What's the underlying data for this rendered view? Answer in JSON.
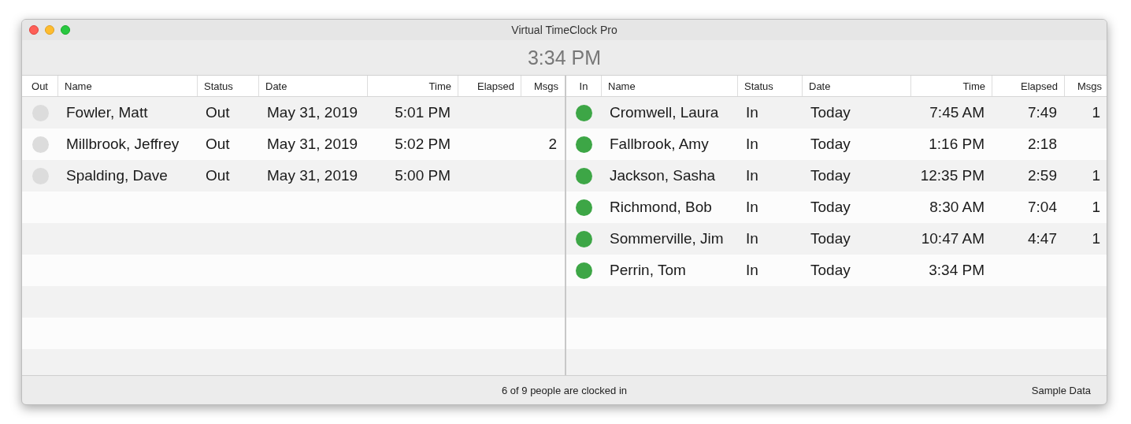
{
  "window": {
    "title": "Virtual TimeClock Pro"
  },
  "clock": "3:34 PM",
  "out_table": {
    "columns": [
      "Out",
      "Name",
      "Status",
      "Date",
      "Time",
      "Elapsed",
      "Msgs"
    ],
    "rows": [
      {
        "clocked_in": false,
        "name": "Fowler, Matt",
        "status": "Out",
        "date": "May 31, 2019",
        "time": "5:01 PM",
        "elapsed": "",
        "msgs": ""
      },
      {
        "clocked_in": false,
        "name": "Millbrook, Jeffrey",
        "status": "Out",
        "date": "May 31, 2019",
        "time": "5:02 PM",
        "elapsed": "",
        "msgs": "2"
      },
      {
        "clocked_in": false,
        "name": "Spalding, Dave",
        "status": "Out",
        "date": "May 31, 2019",
        "time": "5:00 PM",
        "elapsed": "",
        "msgs": ""
      }
    ]
  },
  "in_table": {
    "columns": [
      "In",
      "Name",
      "Status",
      "Date",
      "Time",
      "Elapsed",
      "Msgs"
    ],
    "rows": [
      {
        "clocked_in": true,
        "name": "Cromwell, Laura",
        "status": "In",
        "date": "Today",
        "time": "7:45 AM",
        "elapsed": "7:49",
        "msgs": "1"
      },
      {
        "clocked_in": true,
        "name": "Fallbrook, Amy",
        "status": "In",
        "date": "Today",
        "time": "1:16 PM",
        "elapsed": "2:18",
        "msgs": ""
      },
      {
        "clocked_in": true,
        "name": "Jackson, Sasha",
        "status": "In",
        "date": "Today",
        "time": "12:35 PM",
        "elapsed": "2:59",
        "msgs": "1"
      },
      {
        "clocked_in": true,
        "name": "Richmond, Bob",
        "status": "In",
        "date": "Today",
        "time": "8:30 AM",
        "elapsed": "7:04",
        "msgs": "1"
      },
      {
        "clocked_in": true,
        "name": "Sommerville, Jim",
        "status": "In",
        "date": "Today",
        "time": "10:47 AM",
        "elapsed": "4:47",
        "msgs": "1"
      },
      {
        "clocked_in": true,
        "name": "Perrin, Tom",
        "status": "In",
        "date": "Today",
        "time": "3:34 PM",
        "elapsed": "",
        "msgs": ""
      }
    ]
  },
  "status_bar": {
    "summary": "6 of 9 people are clocked in",
    "mode": "Sample Data"
  }
}
